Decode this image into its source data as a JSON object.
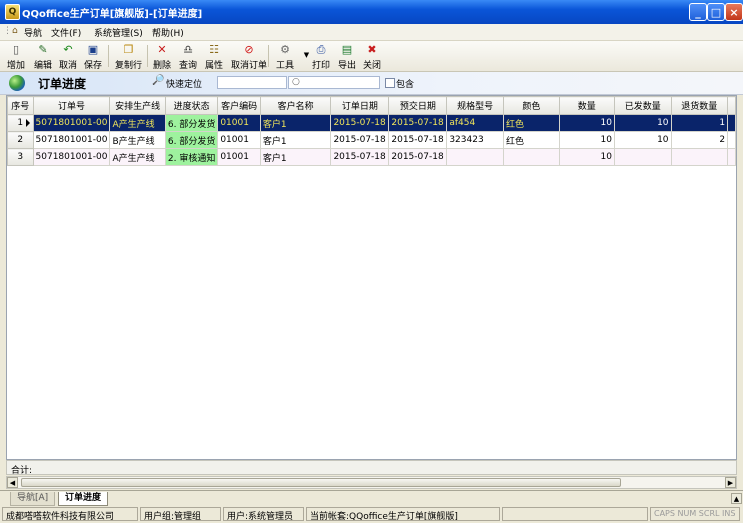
{
  "window": {
    "title": "QQoffice生产订单[旗舰版]-[订单进度]",
    "min": "_",
    "max": "□",
    "close": "×"
  },
  "menu": {
    "items": [
      "导航",
      "文件(F)",
      "系统管理(S)",
      "帮助(H)"
    ]
  },
  "toolbar": {
    "add": "增加",
    "edit": "编辑",
    "cancel": "取消",
    "save": "保存",
    "copy_row": "复制行",
    "delete": "删除",
    "query": "查询",
    "properties": "属性",
    "cancel_order": "取消订单",
    "tools": "工具",
    "print": "打印",
    "export": "导出",
    "close": "关闭"
  },
  "header": {
    "title": "订单进度",
    "quick_locate": "快速定位",
    "include": "包含"
  },
  "table": {
    "columns": [
      "序号",
      "订单号",
      "安排生产线",
      "进度状态",
      "客户编码",
      "客户名称",
      "订单日期",
      "预交日期",
      "规格型号",
      "颜色",
      "数量",
      "已发数量",
      "退货数量"
    ],
    "rows": [
      {
        "no": "1",
        "order_no": "5071801001-00",
        "line": "A产生产线",
        "status": "6. 部分发货",
        "cust_code": "01001",
        "cust_name": "客户1",
        "order_date": "2015-07-18",
        "due_date": "2015-07-18",
        "spec": "af454",
        "color": "红色",
        "qty": "10",
        "shipped": "10",
        "returned": "1"
      },
      {
        "no": "2",
        "order_no": "5071801001-00",
        "line": "B产生产线",
        "status": "6. 部分发货",
        "cust_code": "01001",
        "cust_name": "客户1",
        "order_date": "2015-07-18",
        "due_date": "2015-07-18",
        "spec": "323423",
        "color": "红色",
        "qty": "10",
        "shipped": "10",
        "returned": "2"
      },
      {
        "no": "3",
        "order_no": "5071801001-00",
        "line": "A产生产线",
        "status": "2. 审核通知",
        "cust_code": "01001",
        "cust_name": "客户1",
        "order_date": "2015-07-18",
        "due_date": "2015-07-18",
        "spec": "",
        "color": "",
        "qty": "10",
        "shipped": "",
        "returned": ""
      }
    ]
  },
  "summary": {
    "label": "合计:"
  },
  "tabs": {
    "nav": "导航[A]",
    "progress": "订单进度"
  },
  "status": {
    "company": "成都嗒嗒软件科技有限公司",
    "group": "用户组:管理组",
    "user": "用户:系统管理员",
    "account": "当前帐套:QQoffice生产订单[旗舰版]",
    "keys": "CAPS NUM SCRL INS"
  }
}
